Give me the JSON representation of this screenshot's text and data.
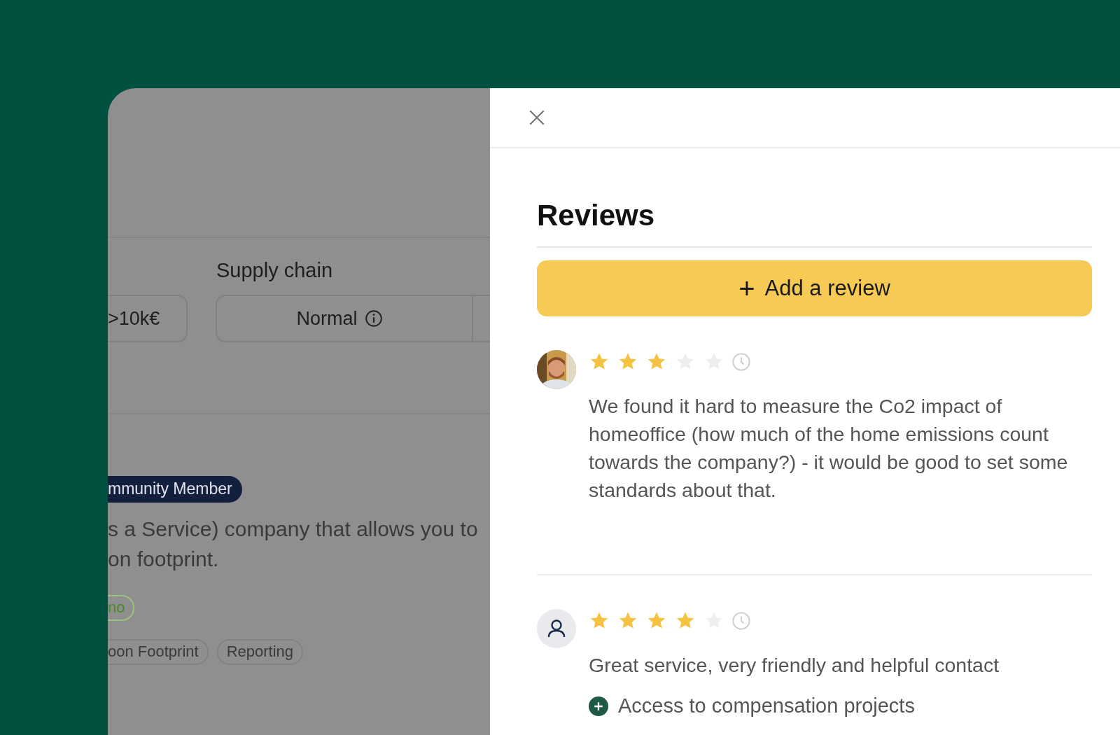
{
  "background_page": {
    "column_heading": "Supply chain",
    "values": [
      {
        "text": ">10k€",
        "info": false
      },
      {
        "text": "Normal",
        "info": true
      }
    ],
    "badge": "mmunity Member",
    "description": "s a Service) company that allows you to\non footprint.",
    "green_tag": "no",
    "tags": [
      "oon Footprint",
      "Reporting"
    ]
  },
  "drawer": {
    "title": "Reviews",
    "add_button": {
      "icon": "+",
      "label": "Add a review"
    },
    "reviews": [
      {
        "stars": 3,
        "text": "We found it hard to measure the Co2 impact of homeoffice (how much of the home emissions count towards the company?) - it would be good to set some standards about that."
      },
      {
        "kind": "generic",
        "stars": 4,
        "text": "Great service, very friendly and helpful contact",
        "pros": [
          "Access to compensation projects"
        ]
      }
    ]
  }
}
